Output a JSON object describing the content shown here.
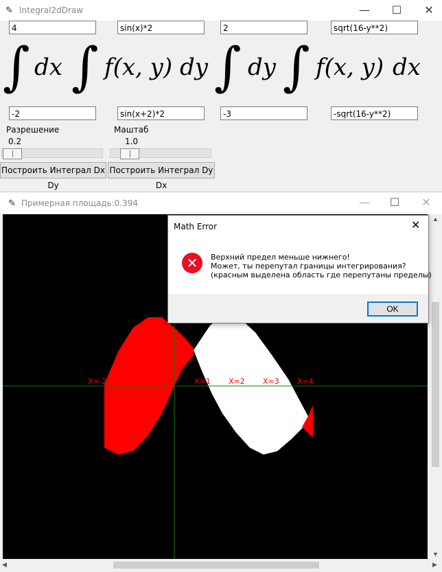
{
  "main_window": {
    "title": "Integral2dDraw",
    "controls": {
      "minimize": "—",
      "maximize": "☐",
      "close": "✕"
    },
    "inputs": {
      "dxdy_upper_x": "4",
      "dxdy_upper_y": "sin(x)*2",
      "dydx_upper_y": "2",
      "dydx_upper_x": "sqrt(16-y**2)",
      "dxdy_lower_x": "-2",
      "dxdy_lower_y": "sin(x+2)*2",
      "dydx_lower_y": "-3",
      "dydx_lower_x": "-sqrt(16-y**2)"
    },
    "formula": {
      "integral": "∫",
      "dx": "dx",
      "dy": "dy",
      "fxy": "f(x, y)"
    },
    "resolution": {
      "label": "Разрешение",
      "value": "0.2",
      "position_fraction": 0.0
    },
    "scale": {
      "label": "Маштаб",
      "value": "1.0",
      "position_fraction": 0.0
    },
    "buttons": {
      "build_dxdy": "Построить Интеграл Dx Dy",
      "build_dydx": "Построить Интеграл Dy Dx"
    }
  },
  "plot_window": {
    "title": "Примерная площадь:0.394",
    "controls": {
      "minimize": "—",
      "maximize": "☐",
      "close": "✕"
    },
    "axis_labels": [
      "X=-2",
      "X=1",
      "X=2",
      "X=3",
      "X=4"
    ],
    "colors": {
      "background": "#000000",
      "axes": "#008000",
      "normal_region": "#ffffff",
      "swapped_region": "#ff0000",
      "labels": "#ff0000"
    }
  },
  "dialog": {
    "title": "Math Error",
    "close": "✕",
    "icon": "error-icon",
    "message_line1": "Верхний предел меньше нижнего!",
    "message_line2": "Может, ты перепутал границы интегрирования?",
    "message_line3": "(красным выделена область где перепутаны пределы)",
    "ok_label": "OK"
  }
}
